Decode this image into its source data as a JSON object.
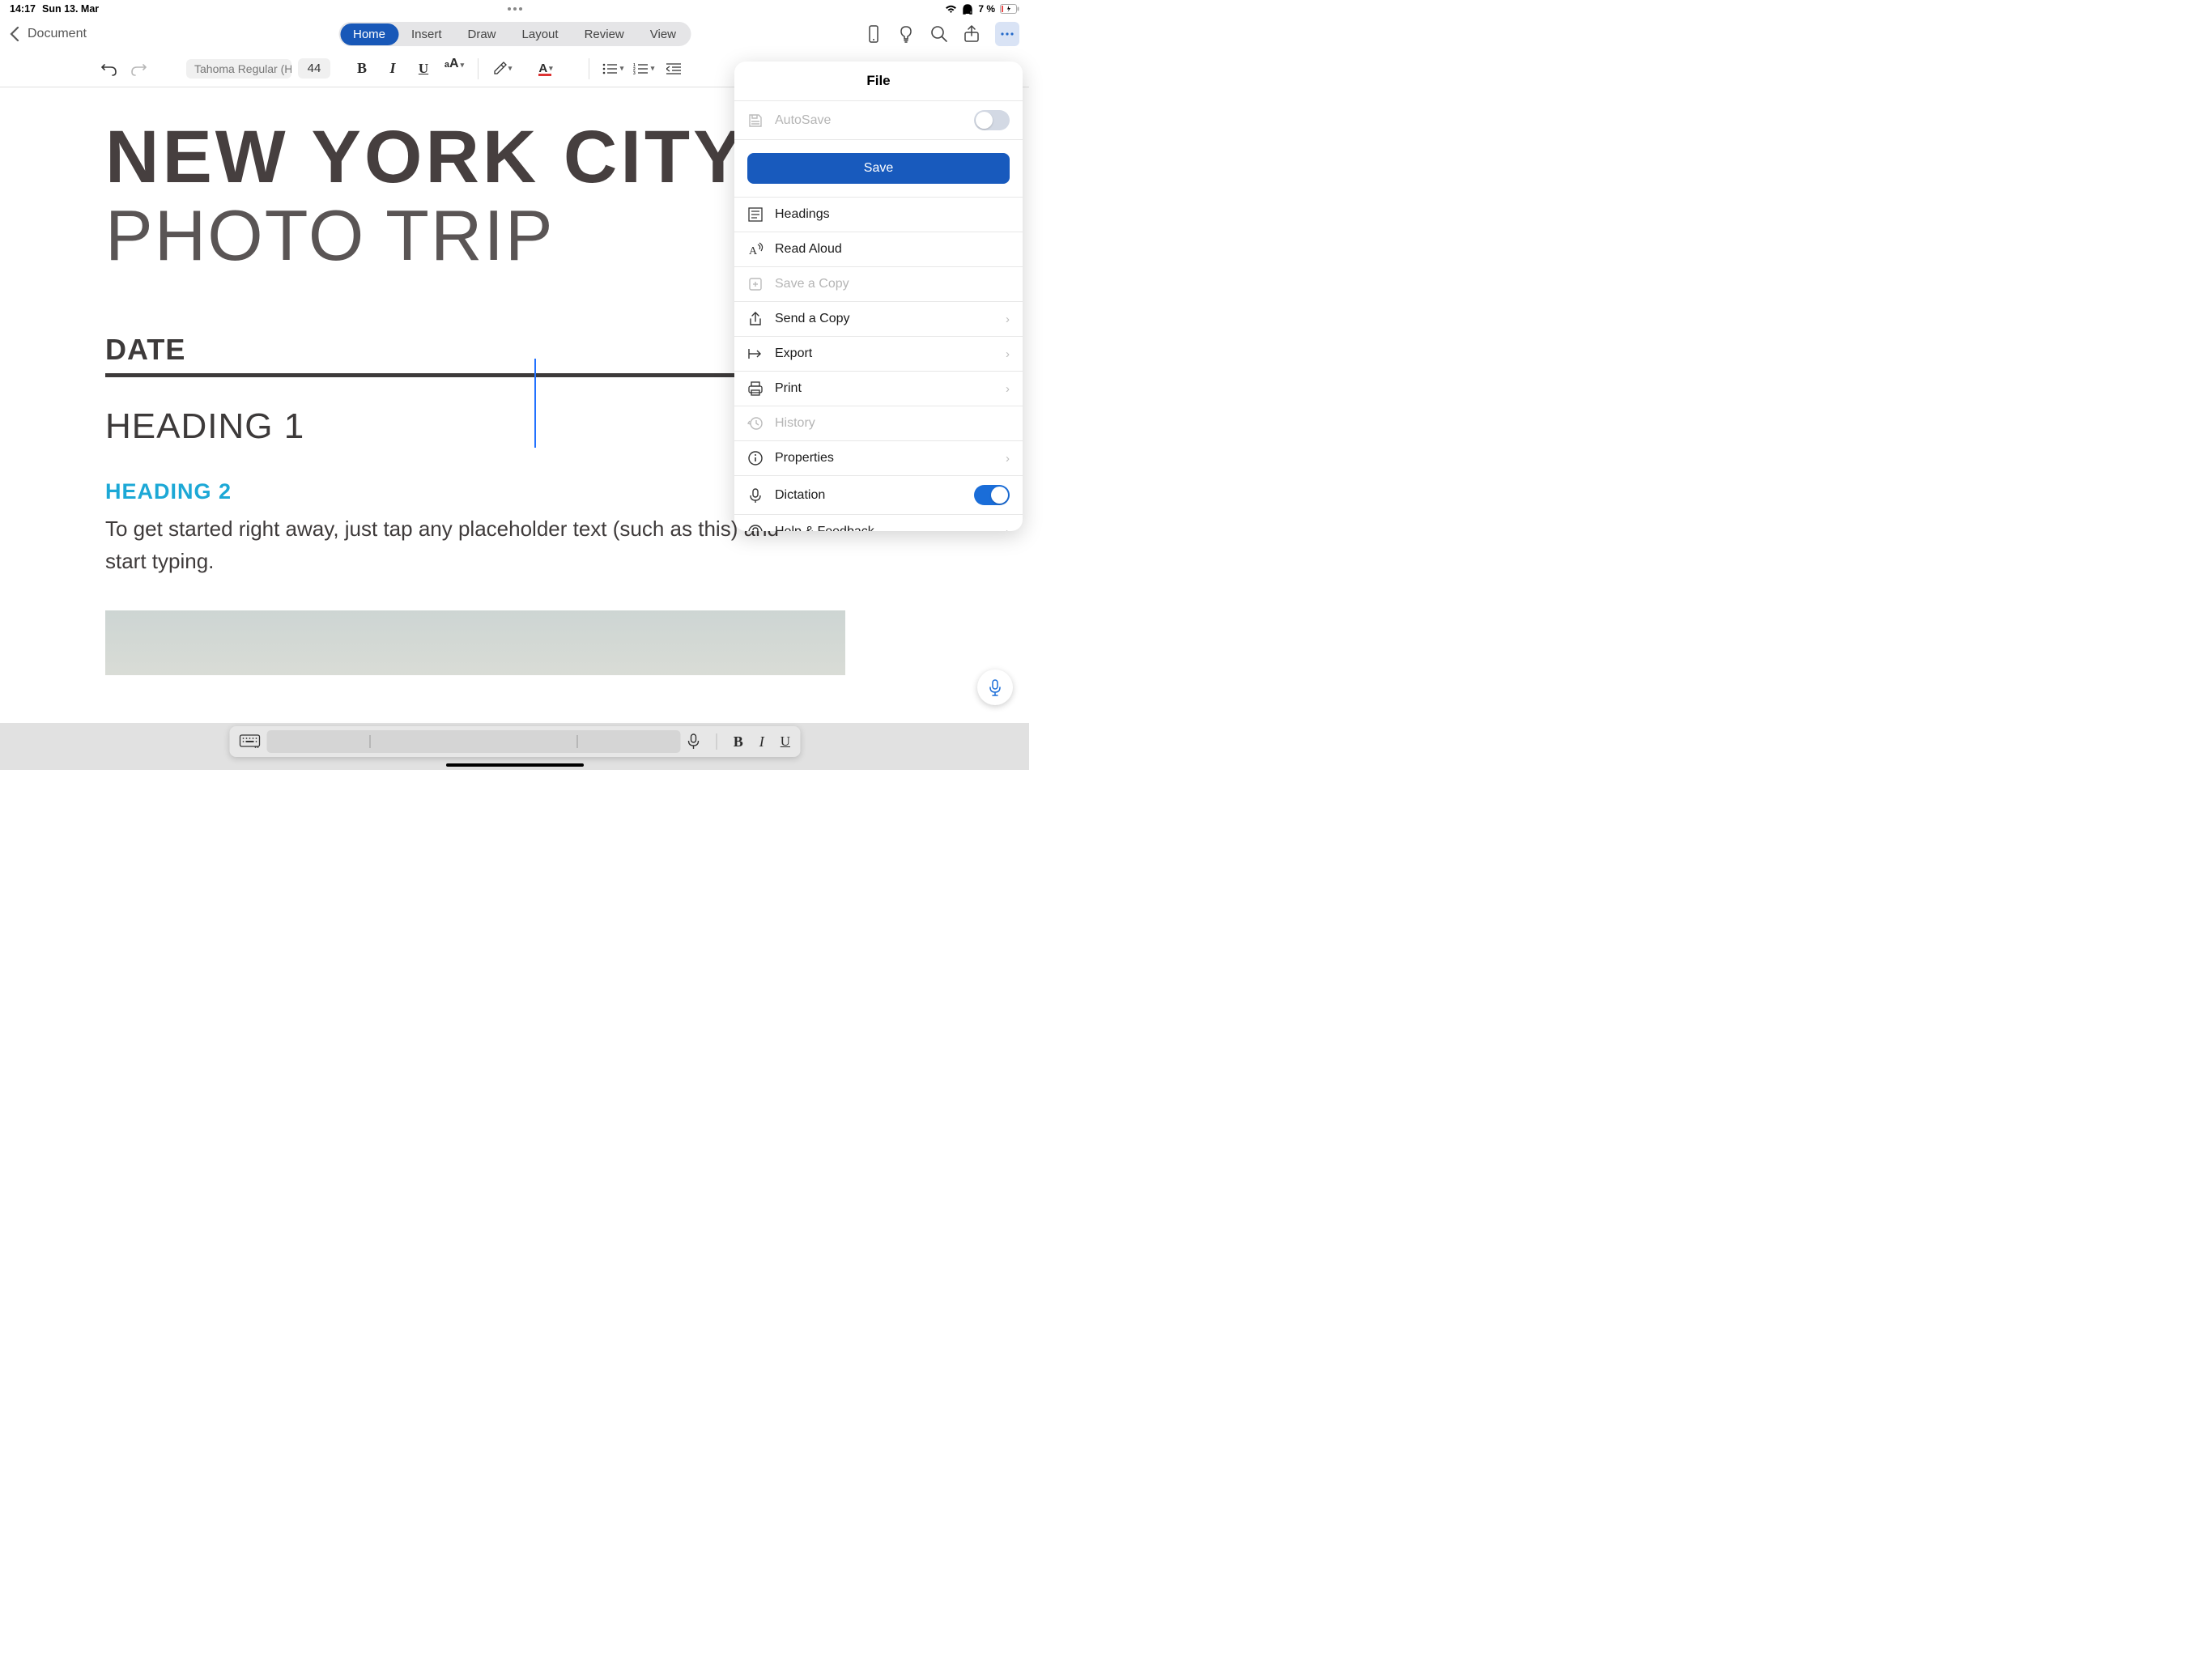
{
  "status": {
    "time": "14:17",
    "date": "Sun 13. Mar",
    "battery": "7 %"
  },
  "header": {
    "back_label": "Document",
    "tabs": [
      {
        "label": "Home",
        "active": true
      },
      {
        "label": "Insert",
        "active": false
      },
      {
        "label": "Draw",
        "active": false
      },
      {
        "label": "Layout",
        "active": false
      },
      {
        "label": "Review",
        "active": false
      },
      {
        "label": "View",
        "active": false
      }
    ]
  },
  "toolbar": {
    "font_name": "Tahoma Regular (H",
    "font_size": "44"
  },
  "document": {
    "title": "NEW YORK CITY",
    "subtitle": "PHOTO TRIP",
    "date_label": "DATE",
    "heading1": "HEADING 1",
    "heading2": "HEADING 2",
    "body": "To get started right away, just tap any placeholder text (such as this) and start typing."
  },
  "file_panel": {
    "title": "File",
    "autosave": {
      "label": "AutoSave",
      "on": false
    },
    "save_label": "Save",
    "items": [
      {
        "id": "headings",
        "label": "Headings",
        "disabled": false,
        "chevron": false
      },
      {
        "id": "read-aloud",
        "label": "Read Aloud",
        "disabled": false,
        "chevron": false
      },
      {
        "id": "save-copy",
        "label": "Save a Copy",
        "disabled": true,
        "chevron": false
      },
      {
        "id": "send-copy",
        "label": "Send a Copy",
        "disabled": false,
        "chevron": true
      },
      {
        "id": "export",
        "label": "Export",
        "disabled": false,
        "chevron": true
      },
      {
        "id": "print",
        "label": "Print",
        "disabled": false,
        "chevron": true
      },
      {
        "id": "history",
        "label": "History",
        "disabled": true,
        "chevron": false
      },
      {
        "id": "properties",
        "label": "Properties",
        "disabled": false,
        "chevron": true
      }
    ],
    "dictation": {
      "label": "Dictation",
      "on": true
    },
    "help": {
      "label": "Help & Feedback"
    }
  }
}
